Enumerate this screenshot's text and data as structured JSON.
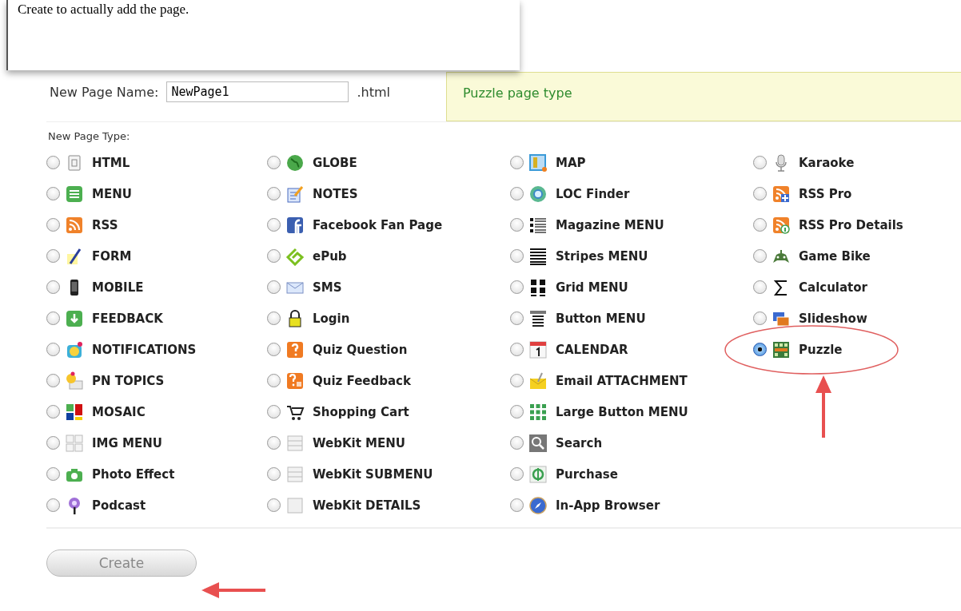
{
  "caption": "Create to actually add the page.",
  "name_field": {
    "label": "New Page Name:",
    "value": "NewPage1",
    "suffix": ".html"
  },
  "info_panel": {
    "text": "Puzzle page type"
  },
  "page_type": {
    "label": "New Page Type:",
    "columns": [
      [
        {
          "label": "HTML",
          "selected": false
        },
        {
          "label": "MENU",
          "selected": false
        },
        {
          "label": "RSS",
          "selected": false
        },
        {
          "label": "FORM",
          "selected": false
        },
        {
          "label": "MOBILE",
          "selected": false
        },
        {
          "label": "FEEDBACK",
          "selected": false
        },
        {
          "label": "NOTIFICATIONS",
          "selected": false
        },
        {
          "label": "PN TOPICS",
          "selected": false
        },
        {
          "label": "MOSAIC",
          "selected": false
        },
        {
          "label": "IMG MENU",
          "selected": false
        },
        {
          "label": "Photo Effect",
          "selected": false
        },
        {
          "label": "Podcast",
          "selected": false
        }
      ],
      [
        {
          "label": "GLOBE",
          "selected": false
        },
        {
          "label": "NOTES",
          "selected": false
        },
        {
          "label": "Facebook Fan Page",
          "selected": false
        },
        {
          "label": "ePub",
          "selected": false
        },
        {
          "label": "SMS",
          "selected": false
        },
        {
          "label": "Login",
          "selected": false
        },
        {
          "label": "Quiz Question",
          "selected": false
        },
        {
          "label": "Quiz Feedback",
          "selected": false
        },
        {
          "label": "Shopping Cart",
          "selected": false
        },
        {
          "label": "WebKit MENU",
          "selected": false
        },
        {
          "label": "WebKit SUBMENU",
          "selected": false
        },
        {
          "label": "WebKit DETAILS",
          "selected": false
        }
      ],
      [
        {
          "label": "MAP",
          "selected": false
        },
        {
          "label": "LOC Finder",
          "selected": false
        },
        {
          "label": "Magazine MENU",
          "selected": false
        },
        {
          "label": "Stripes MENU",
          "selected": false
        },
        {
          "label": "Grid MENU",
          "selected": false
        },
        {
          "label": "Button MENU",
          "selected": false
        },
        {
          "label": "CALENDAR",
          "selected": false
        },
        {
          "label": "Email ATTACHMENT",
          "selected": false
        },
        {
          "label": "Large Button MENU",
          "selected": false
        },
        {
          "label": "Search",
          "selected": false
        },
        {
          "label": "Purchase",
          "selected": false
        },
        {
          "label": "In-App Browser",
          "selected": false
        }
      ],
      [
        {
          "label": "Karaoke",
          "selected": false
        },
        {
          "label": "RSS Pro",
          "selected": false
        },
        {
          "label": "RSS Pro Details",
          "selected": false
        },
        {
          "label": "Game Bike",
          "selected": false
        },
        {
          "label": "Calculator",
          "selected": false
        },
        {
          "label": "Slideshow",
          "selected": false
        },
        {
          "label": "Puzzle",
          "selected": true
        }
      ]
    ]
  },
  "buttons": [
    {
      "label": "Create",
      "disabled": true
    }
  ]
}
